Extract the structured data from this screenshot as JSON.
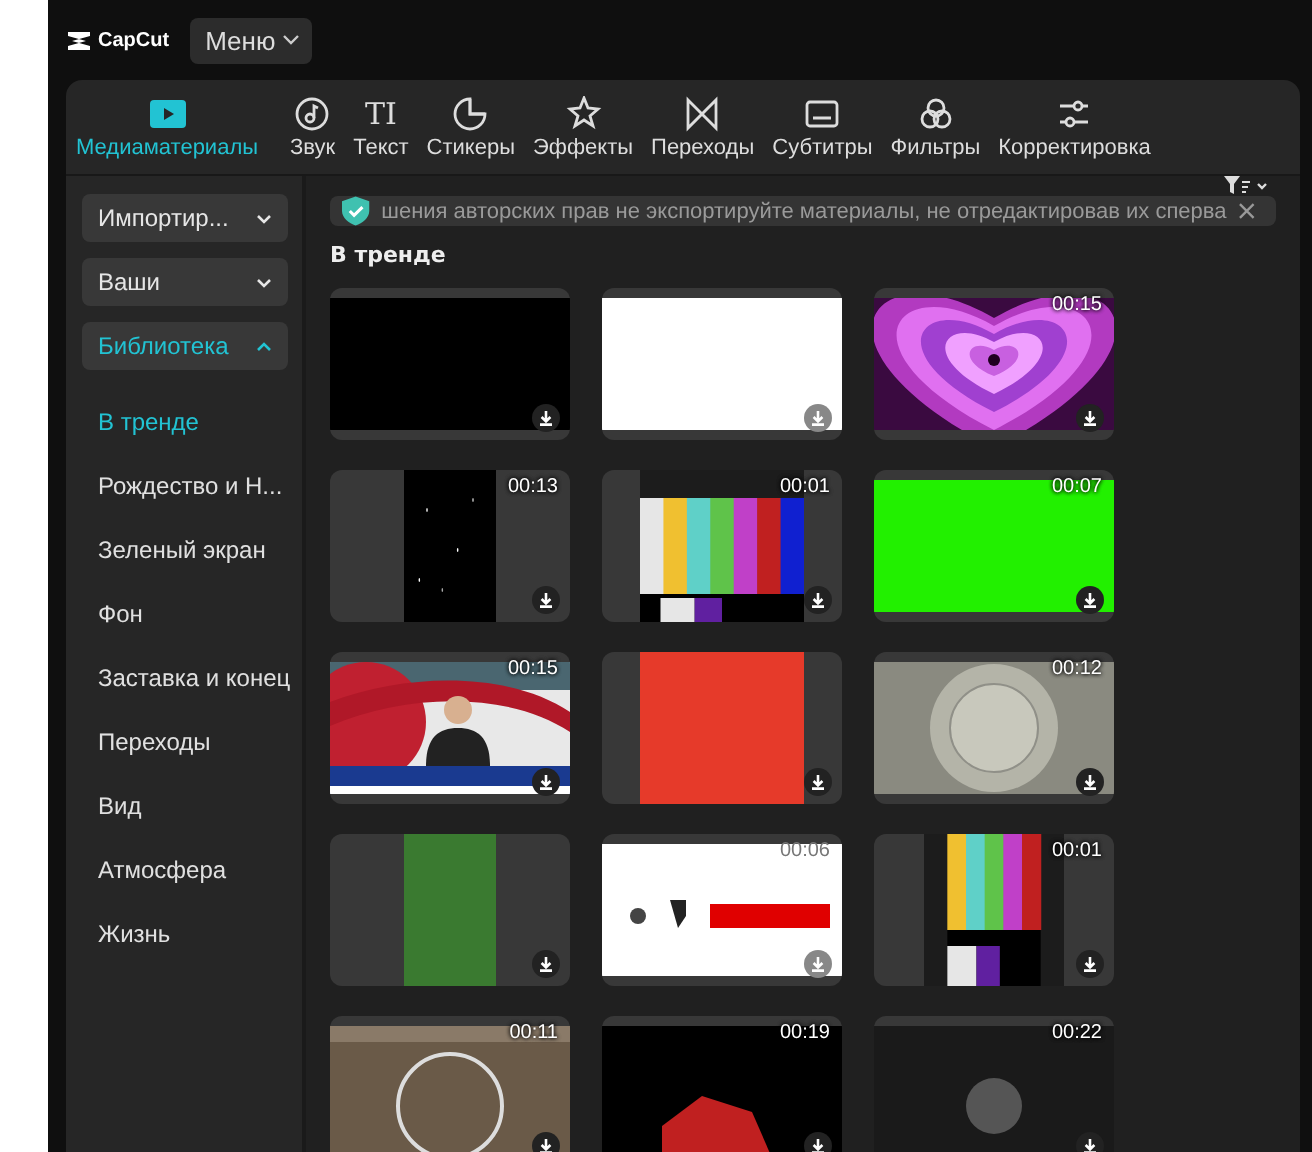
{
  "app": {
    "name": "CapCut",
    "menu": "Меню"
  },
  "tabs": [
    {
      "kind": "media",
      "label": "Медиаматериалы",
      "selected": true
    },
    {
      "kind": "audio",
      "label": "Звук",
      "selected": false
    },
    {
      "kind": "text",
      "label": "Текст",
      "glyph": "TI",
      "selected": false
    },
    {
      "kind": "stickers",
      "label": "Стикеры",
      "selected": false
    },
    {
      "kind": "effects",
      "label": "Эффекты",
      "selected": false
    },
    {
      "kind": "transitions",
      "label": "Переходы",
      "selected": false
    },
    {
      "kind": "captions",
      "label": "Субтитры",
      "selected": false
    },
    {
      "kind": "filters",
      "label": "Фильтры",
      "selected": false
    },
    {
      "kind": "adjust",
      "label": "Корректировка",
      "selected": false
    }
  ],
  "sidebar": {
    "dropdowns": [
      {
        "label": "Импортир...",
        "expanded": false,
        "selected": false
      },
      {
        "label": "Ваши",
        "expanded": false,
        "selected": false
      },
      {
        "label": "Библиотека",
        "expanded": true,
        "selected": true
      }
    ],
    "items": [
      {
        "label": "В тренде",
        "selected": true
      },
      {
        "label": "Рождество и Н...",
        "selected": false
      },
      {
        "label": "Зеленый экран",
        "selected": false
      },
      {
        "label": "Фон",
        "selected": false
      },
      {
        "label": "Заставка и конец",
        "selected": false
      },
      {
        "label": "Переходы",
        "selected": false
      },
      {
        "label": "Вид",
        "selected": false
      },
      {
        "label": "Атмосфера",
        "selected": false
      },
      {
        "label": "Жизнь",
        "selected": false
      }
    ]
  },
  "notice": {
    "text": "шения авторских прав не экспортируйте материалы, не отредактировав их сперва"
  },
  "section": {
    "title": "В тренде"
  },
  "media": [
    {
      "kind": "picture"
    },
    {
      "kind": "picture"
    },
    {
      "kind": "picture",
      "duration": "00:15"
    },
    {
      "kind": "picture",
      "duration": "00:13"
    },
    {
      "kind": "picture",
      "duration": "00:01"
    },
    {
      "kind": "picture",
      "duration": "00:07"
    },
    {
      "kind": "picture",
      "duration": "00:15"
    },
    {
      "kind": "picture"
    },
    {
      "kind": "picture",
      "duration": "00:12"
    },
    {
      "kind": "picture"
    },
    {
      "kind": "picture",
      "duration": "00:06"
    },
    {
      "kind": "picture",
      "duration": "00:01"
    },
    {
      "kind": "picture",
      "duration": "00:11"
    },
    {
      "kind": "picture",
      "duration": "00:19"
    },
    {
      "kind": "picture",
      "duration": "00:22"
    }
  ]
}
